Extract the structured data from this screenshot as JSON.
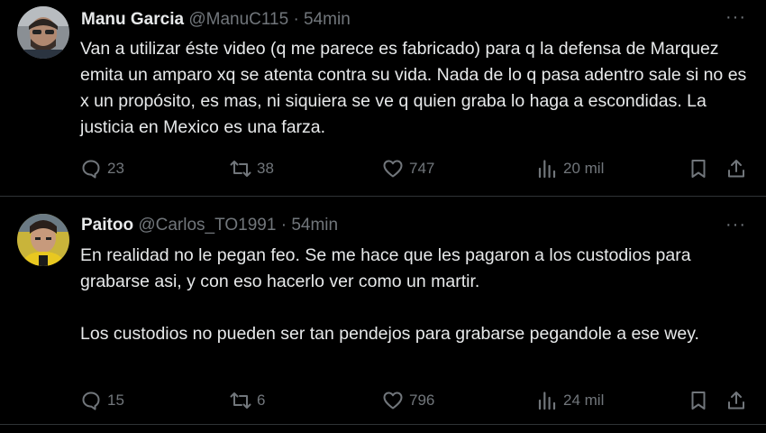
{
  "tweets": [
    {
      "name": "Manu Garcia",
      "handle": "@ManuC115",
      "separator": "·",
      "time": "54min",
      "more": "···",
      "paragraphs": [
        "Van a utilizar éste video (q me parece es fabricado) para q la defensa de Marquez emita un amparo xq se atenta contra su vida. Nada de lo q pasa adentro sale si no es x un propósito, es mas, ni siquiera se ve q quien graba lo haga a escondidas. La justicia en Mexico es una farza."
      ],
      "replies": "23",
      "retweets": "38",
      "likes": "747",
      "views": "20 mil"
    },
    {
      "name": "Paitoo",
      "handle": "@Carlos_TO1991",
      "separator": "·",
      "time": "54min",
      "more": "···",
      "paragraphs": [
        "En realidad no le pegan feo. Se me hace que les pagaron a los custodios para grabarse asi, y con eso hacerlo ver como un martir.",
        "Los custodios no pueden ser tan pendejos para grabarse pegandole a ese wey."
      ],
      "replies": "15",
      "retweets": "6",
      "likes": "796",
      "views": "24 mil"
    }
  ],
  "icons": {
    "reply": "reply-icon",
    "retweet": "retweet-icon",
    "like": "heart-icon",
    "views": "views-icon",
    "bookmark": "bookmark-icon",
    "share": "share-icon"
  },
  "colors": {
    "background": "#000000",
    "text": "#e7e9ea",
    "muted": "#71767b",
    "divider": "#2f3336"
  }
}
